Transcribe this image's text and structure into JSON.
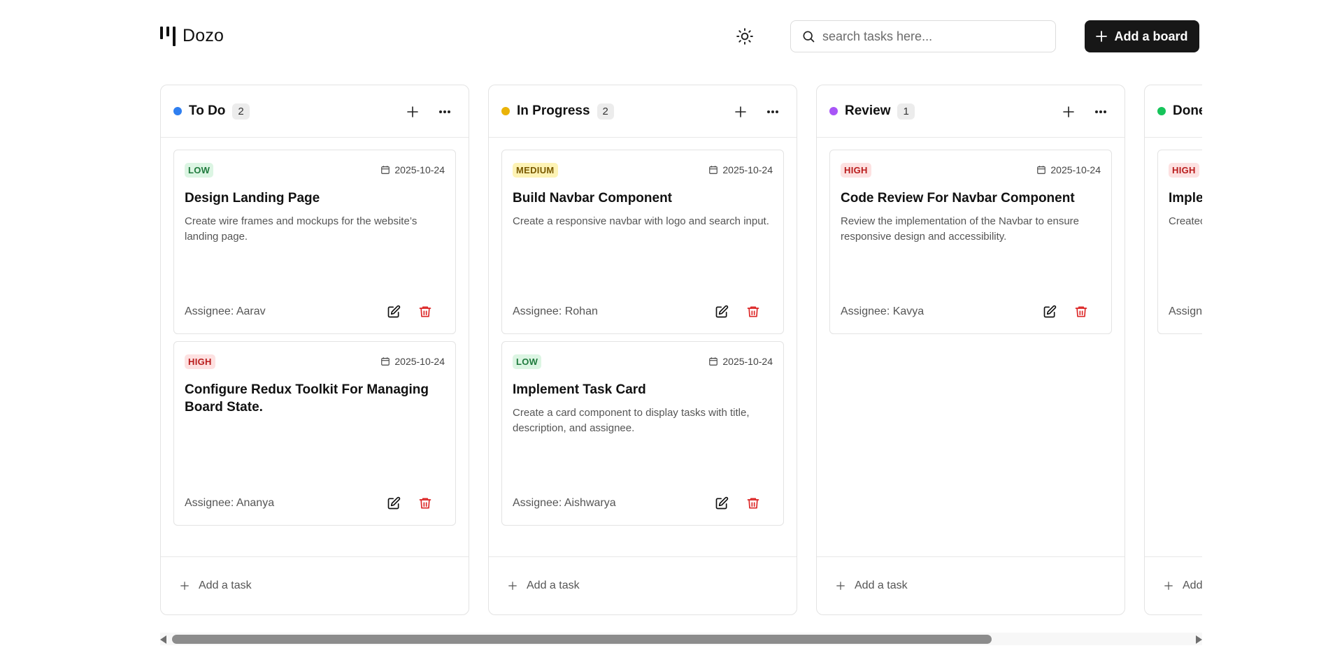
{
  "app": {
    "name": "Dozo"
  },
  "header": {
    "search_placeholder": "search tasks here...",
    "add_board_label": "Add a board",
    "theme_icon": "sun-icon"
  },
  "columns": [
    {
      "title": "To Do",
      "count": "2",
      "color": "#2f7ff0",
      "add_task_label": "Add a task",
      "cards": [
        {
          "priority": "LOW",
          "date": "2025-10-24",
          "title": "Design Landing Page",
          "description": "Create wire frames and mockups for the website’s landing page.",
          "assignee": "Assignee: Aarav"
        },
        {
          "priority": "HIGH",
          "date": "2025-10-24",
          "title": "Configure Redux Toolkit For Managing Board State.",
          "description": "",
          "assignee": "Assignee: Ananya"
        }
      ]
    },
    {
      "title": "In Progress",
      "count": "2",
      "color": "#eab308",
      "add_task_label": "Add a task",
      "cards": [
        {
          "priority": "MEDIUM",
          "date": "2025-10-24",
          "title": "Build Navbar Component",
          "description": "Create a responsive navbar with logo and search input.",
          "assignee": "Assignee: Rohan"
        },
        {
          "priority": "LOW",
          "date": "2025-10-24",
          "title": "Implement Task Card",
          "description": "Create a card component to display tasks with title, description, and assignee.",
          "assignee": "Assignee: Aishwarya"
        }
      ]
    },
    {
      "title": "Review",
      "count": "1",
      "color": "#a855f7",
      "add_task_label": "Add a task",
      "cards": [
        {
          "priority": "HIGH",
          "date": "2025-10-24",
          "title": "Code Review For Navbar Component",
          "description": "Review the implementation of the Navbar to ensure responsive design and accessibility.",
          "assignee": "Assignee: Kavya"
        }
      ]
    },
    {
      "title": "Done",
      "count": "",
      "color": "#16c45a",
      "add_task_label": "Add a task",
      "cards": [
        {
          "priority": "HIGH",
          "date": "",
          "title": "Implen",
          "description": "Createc validatic endpoir",
          "assignee": "Assigne"
        }
      ]
    }
  ],
  "colors": {
    "priority_low_bg": "#dcf5e3",
    "priority_medium_bg": "#fdf3b5",
    "priority_high_bg": "#fde1e1",
    "delete_icon": "#dc2626",
    "primary_button": "#171717"
  }
}
